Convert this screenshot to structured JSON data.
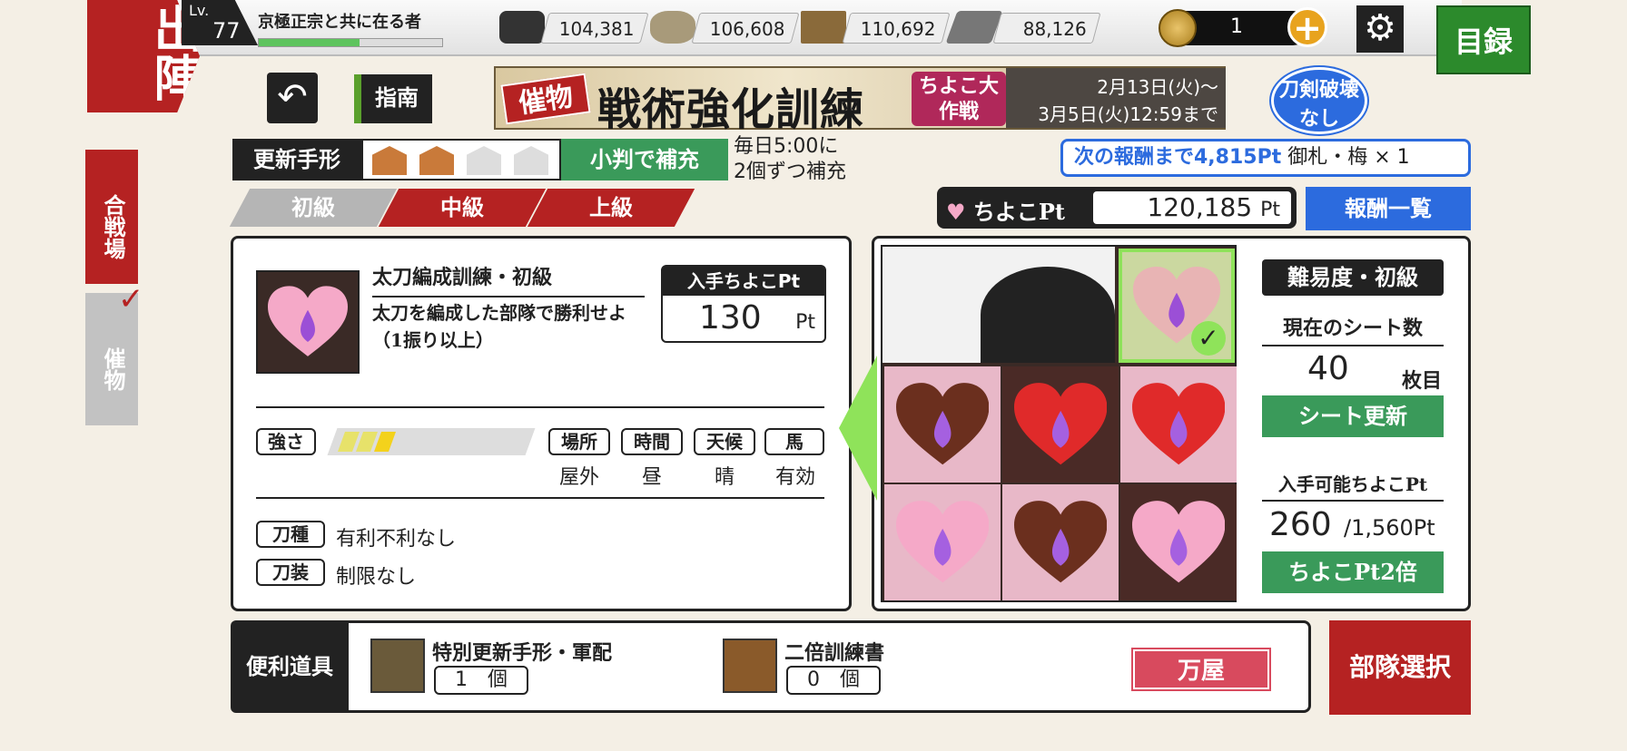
{
  "header": {
    "sortie_label": "出陣",
    "level_label": "Lv.",
    "level": "77",
    "player_name": "京極正宗と共に在る者",
    "exp_progress": 0.55,
    "resources": [
      {
        "icon": "charcoal-icon",
        "value": "104,381"
      },
      {
        "icon": "steel-icon",
        "value": "106,608"
      },
      {
        "icon": "cooling-material-icon",
        "value": "110,692"
      },
      {
        "icon": "whetstone-icon",
        "value": "88,126"
      }
    ],
    "koban_count": "1",
    "plus_label": "+",
    "catalog_label": "目録"
  },
  "sidebar": {
    "tab_gassen": "合戦場",
    "tab_saimotsu": "催物"
  },
  "nav": {
    "back_icon": "undo-arrow-icon",
    "guide_label": "指南"
  },
  "banner": {
    "tag": "催物",
    "title": "戦術強化訓練",
    "subtitle": "ちよこ大作戦",
    "date_start": "2月13日(火)～",
    "date_end": "3月5日(火)12:59まで"
  },
  "no_break_badge": "刀剣破壊なし",
  "refresh": {
    "label": "更新手形",
    "tickets_on": 2,
    "tickets_total": 4,
    "refill_label": "小判で補充",
    "note_line1": "毎日5:00に",
    "note_line2": "2個ずつ補充"
  },
  "level_tabs": [
    "初級",
    "中級",
    "上級"
  ],
  "reward": {
    "next_reward_text": "次の報酬まで4,815Pt",
    "next_reward_item": "御札・梅 × 1",
    "pt_label": "ちよこPt",
    "pt_value": "120,185",
    "pt_unit": "Pt",
    "reward_list_label": "報酬一覧"
  },
  "mission": {
    "title": "太刀編成訓練・初級",
    "description": "太刀を編成した部隊で勝利せよ（1振り以上）",
    "gain_header": "入手ちよこPt",
    "gain_value": "130",
    "gain_unit": "Pt",
    "strength_label": "強さ",
    "strength_level": 3,
    "conditions": [
      {
        "label": "場所",
        "value": "屋外"
      },
      {
        "label": "時間",
        "value": "昼"
      },
      {
        "label": "天候",
        "value": "晴"
      },
      {
        "label": "馬",
        "value": "有効"
      }
    ],
    "sword_type_label": "刀種",
    "sword_type_value": "有利不利なし",
    "equip_label": "刀装",
    "equip_value": "制限なし"
  },
  "sheet": {
    "difficulty": "難易度・初級",
    "sheet_count_label": "現在のシート数",
    "sheet_count": "40",
    "sheet_count_unit": "枚目",
    "refresh_sheet": "シート更新",
    "available_pt_label": "入手可能ちよこPt",
    "available_pt": "260",
    "available_pt_total": "/1,560Pt",
    "double_btn": "ちよこPt2倍",
    "cells": [
      {
        "heart": "chocolate",
        "bg": "pink"
      },
      {
        "heart": "red",
        "bg": "dark"
      },
      {
        "heart": "red",
        "bg": "pink"
      },
      {
        "heart": "pink",
        "bg": "pink"
      },
      {
        "heart": "chocolate",
        "bg": "pink"
      },
      {
        "heart": "pink",
        "bg": "dark"
      }
    ]
  },
  "tools": {
    "label": "便利道具",
    "items": [
      {
        "name": "特別更新手形・軍配",
        "count": "1",
        "unit": "個"
      },
      {
        "name": "二倍訓練書",
        "count": "0",
        "unit": "個"
      }
    ],
    "shop_label": "万屋"
  },
  "select_unit_label": "部隊選択",
  "colors": {
    "red": "#b52222",
    "green": "#3a9a5a",
    "blue": "#2c6bde",
    "heart_pink": "#f5a9c8",
    "heart_red": "#e02a2a",
    "heart_choc": "#6b2f1e"
  }
}
